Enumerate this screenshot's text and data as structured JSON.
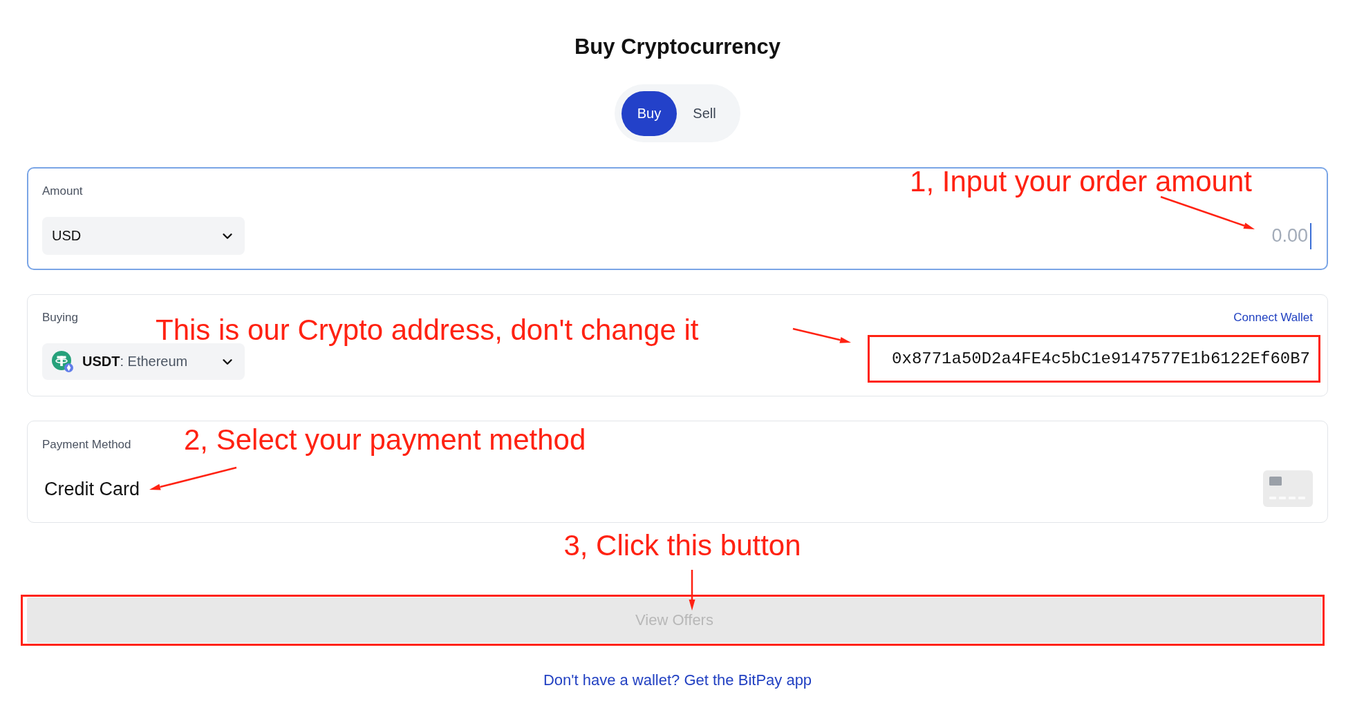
{
  "title": "Buy Cryptocurrency",
  "mode_toggle": [
    {
      "label": "Buy",
      "selected": true
    },
    {
      "label": "Sell",
      "selected": false
    }
  ],
  "amount": {
    "label": "Amount",
    "annotation": "1, Input your order amount",
    "currency": "USD",
    "placeholder": "0.00",
    "focused": true
  },
  "buying": {
    "label": "Buying",
    "connect_wallet": "Connect Wallet",
    "annotation": "This is our Crypto address, don't change it",
    "asset": "**USDT**: Ethereum",
    "address": "0x8771a50D2a4FE4c5bC1e9147577E1b6122Ef60B7",
    "highlighted": true
  },
  "payment": {
    "label": "Payment Method",
    "annotation": "2, Select your payment method",
    "method": "Credit Card"
  },
  "view_offers": {
    "annotation": "3, Click this button",
    "label": "View Offers",
    "disabled": true,
    "highlighted": true
  },
  "footer_link": "Don't have a wallet? Get the BitPay app"
}
